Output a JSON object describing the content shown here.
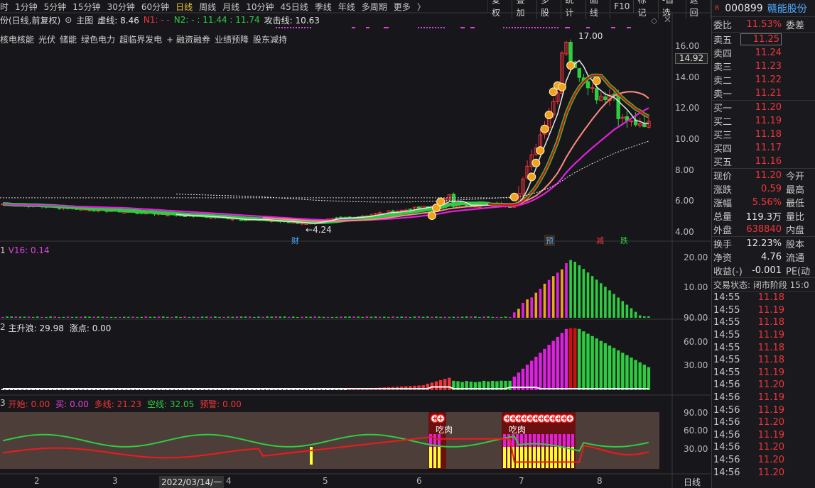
{
  "toolbar": {
    "periods": [
      "时",
      "1分钟",
      "5分钟",
      "15分钟",
      "30分钟",
      "60分钟",
      "日线",
      "周线",
      "月线",
      "10分钟",
      "45日线",
      "季线",
      "年线",
      "多周期",
      "更多"
    ],
    "active_period": "日线",
    "more_arrow": "〉",
    "tools": [
      "复权",
      "叠加",
      "多股",
      "统计",
      "画线",
      "F10",
      "标记",
      "-自选",
      "返回"
    ]
  },
  "main_legend": {
    "name": "份(日线,前复权)",
    "main_label": "主图",
    "xuxian": "虚线: 8.46",
    "n1": "N1: - -",
    "n2": "N2: - : 11.44 : 11.74",
    "attack": "攻击线: 10.63"
  },
  "concepts": [
    "核电核能",
    "光伏",
    "储能",
    "绿色电力",
    "超临界发电",
    "+ 融资融券",
    "业绩预降",
    "股东减持"
  ],
  "y_axis_main": [
    "16.00",
    "14.00",
    "12.00",
    "10.00",
    "8.00",
    "6.00",
    "4.00"
  ],
  "current_price_tag": "14.92",
  "annotations": {
    "high": "17.00",
    "low": "4.24",
    "cai": "财",
    "yu": "预",
    "jian": "减",
    "die": "跌"
  },
  "ind1": {
    "num": "1",
    "label": "V16: 0.14",
    "ticks": [
      "20.00",
      "10.00"
    ]
  },
  "ind2": {
    "num": "2",
    "label1": "主升浪: 29.98",
    "label2": "涨点: 0.00",
    "ticks": [
      "90.00",
      "60.00",
      "30.00"
    ]
  },
  "ind3": {
    "num": "3",
    "items": [
      "开始: 0.00",
      "买: 0.00",
      "多线: 21.23",
      "空线: 32.05",
      "预警: 0.00"
    ],
    "ticks": [
      "90.00",
      "60.00",
      "30.00"
    ],
    "chirou": "吃肉"
  },
  "x_axis": {
    "labels": [
      "2",
      "3",
      "2022/03/14/一",
      "4",
      "5",
      "6",
      "7",
      "8"
    ],
    "period": "日线"
  },
  "chart_data": {
    "type": "candlestick",
    "dates_visible": [
      "2",
      "3",
      "2022/03/14/一",
      "4",
      "5",
      "6",
      "7",
      "8"
    ],
    "price_range": [
      3.7,
      17.3
    ],
    "high": 17.0,
    "low": 4.24,
    "last_close": 11.2
  },
  "quote": {
    "code": "000899",
    "name": "赣能股份",
    "weibi_label": "委比",
    "weibi": "11.53%",
    "weicha_label": "委差",
    "asks": [
      {
        "label": "卖五",
        "price": "11.25"
      },
      {
        "label": "卖四",
        "price": "11.24"
      },
      {
        "label": "卖三",
        "price": "11.23"
      },
      {
        "label": "卖二",
        "price": "11.22"
      },
      {
        "label": "卖一",
        "price": "11.21"
      }
    ],
    "bids": [
      {
        "label": "买一",
        "price": "11.20"
      },
      {
        "label": "买二",
        "price": "11.19"
      },
      {
        "label": "买三",
        "price": "11.18"
      },
      {
        "label": "买四",
        "price": "11.17"
      },
      {
        "label": "买五",
        "price": "11.16"
      }
    ],
    "stats": [
      {
        "label": "现价",
        "value": "11.20",
        "ext": "今开",
        "cls": "red"
      },
      {
        "label": "涨跌",
        "value": "0.59",
        "ext": "最高",
        "cls": "red"
      },
      {
        "label": "涨幅",
        "value": "5.56%",
        "ext": "最低",
        "cls": "red"
      },
      {
        "label": "总量",
        "value": "119.3万",
        "ext": "量比",
        "cls": "white"
      },
      {
        "label": "外盘",
        "value": "638840",
        "ext": "内盘",
        "cls": "red"
      }
    ],
    "stats2": [
      {
        "label": "换手",
        "value": "12.23%",
        "ext": "股本"
      },
      {
        "label": "净资",
        "value": "4.76",
        "ext": "流通"
      },
      {
        "label": "收益(-)",
        "value": "-0.001",
        "ext": "PE(动"
      }
    ],
    "trade_state": "交易状态: 闭市阶段 15:0",
    "ticks": [
      {
        "t": "14:55",
        "p": "11.18"
      },
      {
        "t": "14:55",
        "p": "11.19"
      },
      {
        "t": "14:55",
        "p": "11.18"
      },
      {
        "t": "14:55",
        "p": "11.19"
      },
      {
        "t": "14:55",
        "p": "11.18"
      },
      {
        "t": "14:55",
        "p": "11.18"
      },
      {
        "t": "14:55",
        "p": "11.19"
      },
      {
        "t": "14:56",
        "p": "11.20"
      },
      {
        "t": "14:56",
        "p": "11.19"
      },
      {
        "t": "14:56",
        "p": "11.19"
      },
      {
        "t": "14:56",
        "p": "11.20"
      },
      {
        "t": "14:56",
        "p": "11.19"
      },
      {
        "t": "14:56",
        "p": "11.20"
      },
      {
        "t": "14:56",
        "p": "11.20"
      },
      {
        "t": "14:56",
        "p": "11.20"
      }
    ]
  }
}
